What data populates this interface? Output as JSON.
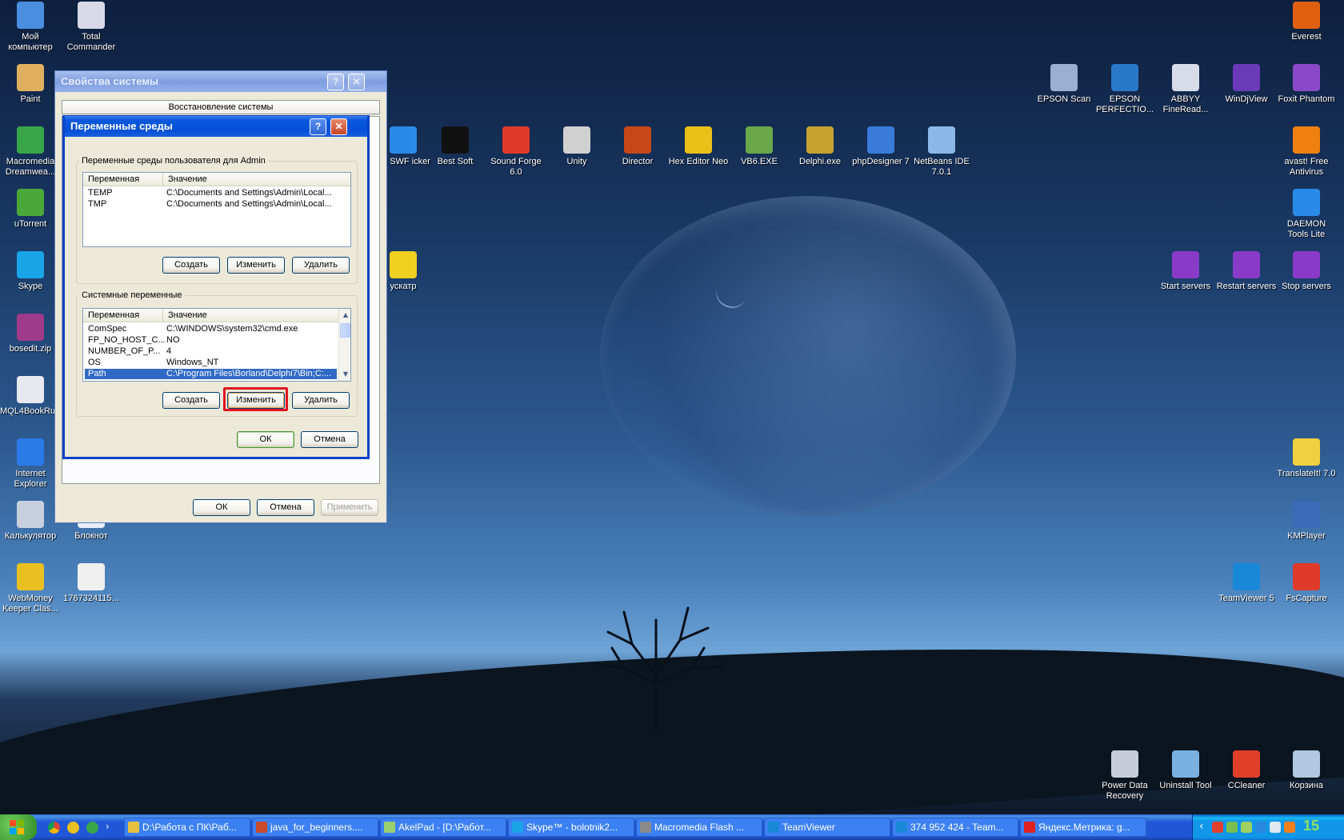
{
  "desktop_icons_left": [
    {
      "name": "my-computer",
      "label": "Мой компьютер",
      "color": "#4a8ee0"
    },
    {
      "name": "total-commander",
      "label": "Total Commander",
      "color": "#d8d8e8"
    },
    {
      "name": "paint",
      "label": "Paint",
      "color": "#e0b060"
    },
    {
      "name": "macromedia-dreamweaver",
      "label": "Macromedia Dreamwea...",
      "color": "#3aa64a"
    },
    {
      "name": "utorrent",
      "label": "uTorrent",
      "color": "#4aa83a"
    },
    {
      "name": "skype",
      "label": "Skype",
      "color": "#1aa4e8"
    },
    {
      "name": "bosedit",
      "label": "bosedit.zip",
      "color": "#a03a8a"
    },
    {
      "name": "mql4book",
      "label": "MQL4BookRu...",
      "color": "#e8e8f0"
    },
    {
      "name": "internet-explorer",
      "label": "Internet Explorer",
      "color": "#2a7ae8"
    },
    {
      "name": "kalkulyator",
      "label": "Калькулятор",
      "color": "#c8d0e0"
    },
    {
      "name": "bloknot",
      "label": "Блокнот",
      "color": "#e8eef8"
    },
    {
      "name": "webmoney",
      "label": "WebMoney Keeper Clas...",
      "color": "#e8c020"
    },
    {
      "name": "file-176",
      "label": "1767324115...",
      "color": "#f0f0f0"
    }
  ],
  "desktop_icons_top": [
    {
      "name": "link-swf-picker",
      "label": "ink SWF icker",
      "color": "#2a8ae8"
    },
    {
      "name": "best-soft",
      "label": "Best Soft",
      "color": "#111111"
    },
    {
      "name": "sound-forge",
      "label": "Sound Forge 6.0",
      "color": "#e03a2a"
    },
    {
      "name": "unity",
      "label": "Unity",
      "color": "#d0d0d0"
    },
    {
      "name": "director",
      "label": "Director",
      "color": "#c8481a"
    },
    {
      "name": "hex-editor-neo",
      "label": "Hex Editor Neo",
      "color": "#e8c018"
    },
    {
      "name": "vb6",
      "label": "VB6.EXE",
      "color": "#6aa84a"
    },
    {
      "name": "delphi",
      "label": "Delphi.exe",
      "color": "#c8a030"
    },
    {
      "name": "phpdesigner",
      "label": "phpDesigner 7",
      "color": "#3a7ad8"
    },
    {
      "name": "netbeans",
      "label": "NetBeans IDE 7.0.1",
      "color": "#8ab8e8"
    },
    {
      "name": "puskatr",
      "label": "ускатр",
      "color": "#f0d020"
    }
  ],
  "desktop_icons_right": [
    {
      "name": "everest",
      "label": "Everest",
      "color": "#e06010"
    },
    {
      "name": "epson-scan",
      "label": "EPSON Scan",
      "color": "#9ab0d0"
    },
    {
      "name": "epson-perfection",
      "label": "EPSON PERFECTIO...",
      "color": "#2a78c8"
    },
    {
      "name": "abbyy-finereader",
      "label": "ABBYY FineRead...",
      "color": "#d8dce8"
    },
    {
      "name": "windjview",
      "label": "WinDjView",
      "color": "#6a3ab8"
    },
    {
      "name": "foxit-phantom",
      "label": "Foxit Phantom",
      "color": "#8a4ac8"
    },
    {
      "name": "avast",
      "label": "avast! Free Antivirus",
      "color": "#f08010"
    },
    {
      "name": "daemon-tools",
      "label": "DAEMON Tools Lite",
      "color": "#2a8ae8"
    },
    {
      "name": "start-servers",
      "label": "Start servers",
      "color": "#8a3ac8"
    },
    {
      "name": "restart-servers",
      "label": "Restart servers",
      "color": "#8a3ac8"
    },
    {
      "name": "stop-servers",
      "label": "Stop servers",
      "color": "#8a3ac8"
    },
    {
      "name": "translateit",
      "label": "TranslateIt! 7.0",
      "color": "#f0d040"
    },
    {
      "name": "kmplayer",
      "label": "KMPlayer",
      "color": "#3a6ab8"
    },
    {
      "name": "teamviewer",
      "label": "TeamViewer 5",
      "color": "#1a88d8"
    },
    {
      "name": "fscapture",
      "label": "FsCapture",
      "color": "#e03a2a"
    },
    {
      "name": "power-data-recovery",
      "label": "Power Data Recovery",
      "color": "#c8ccd8"
    },
    {
      "name": "uninstall-tool",
      "label": "Uninstall Tool",
      "color": "#7ab0e0"
    },
    {
      "name": "ccleaner",
      "label": "CCleaner",
      "color": "#e04028"
    },
    {
      "name": "recycle-bin",
      "label": "Корзина",
      "color": "#b0c8e0"
    }
  ],
  "sys_props": {
    "title": "Свойства системы",
    "tab": "Восстановление системы",
    "ok": "ОК",
    "cancel": "Отмена",
    "apply": "Применить"
  },
  "env_vars": {
    "title": "Переменные среды",
    "user_group_title": "Переменные среды пользователя для Admin",
    "col_var": "Переменная",
    "col_val": "Значение",
    "user_rows": [
      {
        "var": "TEMP",
        "val": "C:\\Documents and Settings\\Admin\\Local..."
      },
      {
        "var": "TMP",
        "val": "C:\\Documents and Settings\\Admin\\Local..."
      }
    ],
    "sys_group_title": "Системные переменные",
    "sys_rows": [
      {
        "var": "ComSpec",
        "val": "C:\\WINDOWS\\system32\\cmd.exe"
      },
      {
        "var": "FP_NO_HOST_C...",
        "val": "NO"
      },
      {
        "var": "NUMBER_OF_P...",
        "val": "4"
      },
      {
        "var": "OS",
        "val": "Windows_NT"
      },
      {
        "var": "Path",
        "val": "C:\\Program Files\\Borland\\Delphi7\\Bin;C:..."
      }
    ],
    "selected_sys_row": "Path",
    "create": "Создать",
    "edit": "Изменить",
    "delete": "Удалить",
    "ok": "ОК",
    "cancel": "Отмена",
    "help_glyph": "?",
    "close_glyph": "✕"
  },
  "taskbar": {
    "tasks": [
      {
        "label": "D:\\Работа с ПК\\Раб...",
        "color": "#e8c040"
      },
      {
        "label": "java_for_beginners....",
        "color": "#c84a2a"
      },
      {
        "label": "AkelPad - [D:\\Работ...",
        "color": "#9ad070"
      },
      {
        "label": "Skype™ - bolotnik2...",
        "color": "#1aa4e8"
      },
      {
        "label": "Macromedia Flash ...",
        "color": "#8a8a8a"
      },
      {
        "label": "TeamViewer",
        "color": "#1a88d8"
      },
      {
        "label": "374 952 424 - Team...",
        "color": "#1a88d8"
      },
      {
        "label": "Яндекс.Метрика: g...",
        "color": "#e02020"
      }
    ],
    "clock": "15"
  },
  "colors": {
    "highlight": "#e0141e",
    "selection": "#316ac5"
  }
}
